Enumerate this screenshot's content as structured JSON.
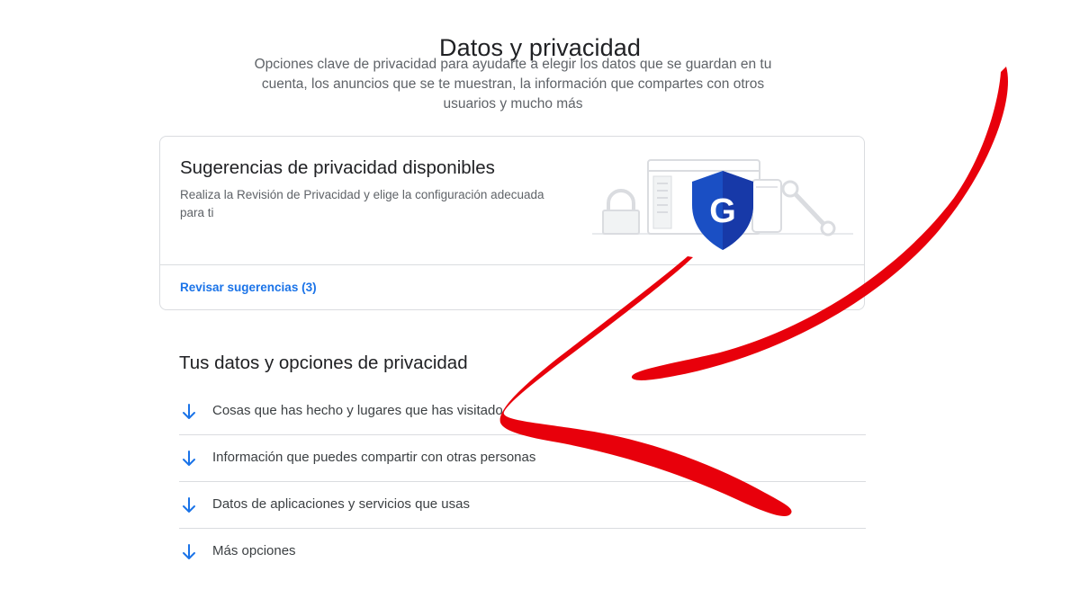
{
  "header": {
    "title": "Datos y privacidad",
    "subtitle": "Opciones clave de privacidad para ayudarte a elegir los datos que se guardan en tu cuenta, los anuncios que se te muestran, la información que compartes con otros usuarios y mucho más"
  },
  "suggestions_card": {
    "title": "Sugerencias de privacidad disponibles",
    "description": "Realiza la Revisión de Privacidad y elige la configuración adecuada para ti",
    "link_label": "Revisar sugerencias (3)",
    "shield_letter": "G",
    "illustration_icons": [
      "lock-icon",
      "browser-window-icon",
      "google-shield-icon",
      "phone-icon",
      "wrench-icon"
    ]
  },
  "privacy_section": {
    "title": "Tus datos y opciones de privacidad",
    "items": [
      {
        "label": "Cosas que has hecho y lugares que has visitado",
        "icon": "arrow-down-icon"
      },
      {
        "label": "Información que puedes compartir con otras personas",
        "icon": "arrow-down-icon"
      },
      {
        "label": "Datos de aplicaciones y servicios que usas",
        "icon": "arrow-down-icon"
      },
      {
        "label": "Más opciones",
        "icon": "arrow-down-icon"
      }
    ]
  },
  "colors": {
    "link_blue": "#1a73e8",
    "annotation_red": "#e8000b",
    "shield_blue": "#1a4fc4",
    "divider": "#dadce0"
  }
}
